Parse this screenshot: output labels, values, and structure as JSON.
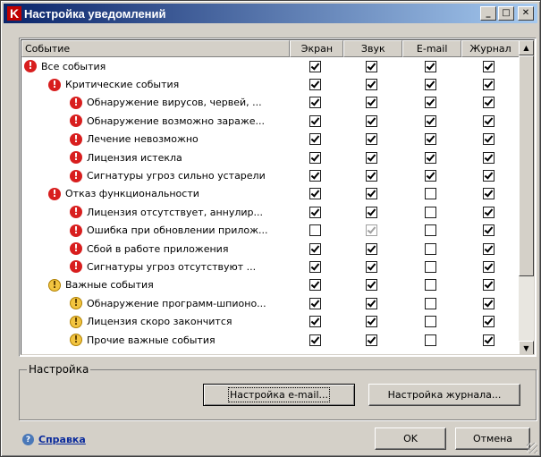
{
  "window": {
    "title": "Настройка уведомлений"
  },
  "titlebar_buttons": {
    "minimize": "_",
    "maximize": "□",
    "close": "✕"
  },
  "columns": {
    "event": "Событие",
    "screen": "Экран",
    "sound": "Звук",
    "email": "E-mail",
    "journal": "Журнал"
  },
  "rows": [
    {
      "level": 0,
      "icon": "critical-icon",
      "label": "Все события",
      "screen": true,
      "sound": true,
      "email": true,
      "journal": true
    },
    {
      "level": 1,
      "icon": "critical-icon",
      "label": "Критические события",
      "screen": true,
      "sound": true,
      "email": true,
      "journal": true
    },
    {
      "level": 2,
      "icon": "critical-icon",
      "label": "Обнаружение вирусов, червей, ...",
      "screen": true,
      "sound": true,
      "email": true,
      "journal": true
    },
    {
      "level": 2,
      "icon": "critical-icon",
      "label": "Обнаружение возможно зараже...",
      "screen": true,
      "sound": true,
      "email": true,
      "journal": true
    },
    {
      "level": 2,
      "icon": "critical-icon",
      "label": "Лечение невозможно",
      "screen": true,
      "sound": true,
      "email": true,
      "journal": true
    },
    {
      "level": 2,
      "icon": "critical-icon",
      "label": "Лицензия истекла",
      "screen": true,
      "sound": true,
      "email": true,
      "journal": true
    },
    {
      "level": 2,
      "icon": "critical-icon",
      "label": "Сигнатуры угроз сильно устарели",
      "screen": true,
      "sound": true,
      "email": true,
      "journal": true
    },
    {
      "level": 1,
      "icon": "critical-icon",
      "label": "Отказ функциональности",
      "screen": true,
      "sound": true,
      "email": false,
      "journal": true
    },
    {
      "level": 2,
      "icon": "critical-icon",
      "label": "Лицензия отсутствует, аннулир...",
      "screen": true,
      "sound": true,
      "email": false,
      "journal": true
    },
    {
      "level": 2,
      "icon": "critical-icon",
      "label": "Ошибка при обновлении прилож...",
      "screen": false,
      "sound": true,
      "sound_disabled": true,
      "email": false,
      "journal": true
    },
    {
      "level": 2,
      "icon": "critical-icon",
      "label": "Сбой в работе приложения",
      "screen": true,
      "sound": true,
      "email": false,
      "journal": true
    },
    {
      "level": 2,
      "icon": "critical-icon",
      "label": "Сигнатуры угроз отсутствуют ...",
      "screen": true,
      "sound": true,
      "email": false,
      "journal": true
    },
    {
      "level": 1,
      "icon": "warning-icon",
      "label": "Важные события",
      "screen": true,
      "sound": true,
      "email": false,
      "journal": true
    },
    {
      "level": 2,
      "icon": "warning-icon",
      "label": "Обнаружение программ-шпионо...",
      "screen": true,
      "sound": true,
      "email": false,
      "journal": true
    },
    {
      "level": 2,
      "icon": "warning-icon",
      "label": "Лицензия скоро закончится",
      "screen": true,
      "sound": true,
      "email": false,
      "journal": true
    },
    {
      "level": 2,
      "icon": "warning-icon",
      "label": "Прочие важные события",
      "screen": true,
      "sound": true,
      "email": false,
      "journal": true
    }
  ],
  "settings_group": {
    "title": "Настройка",
    "email_button": "Настройка e-mail...",
    "journal_button": "Настройка журнала..."
  },
  "footer": {
    "help_link": "Справка",
    "ok_button": "OK",
    "cancel_button": "Отмена"
  }
}
